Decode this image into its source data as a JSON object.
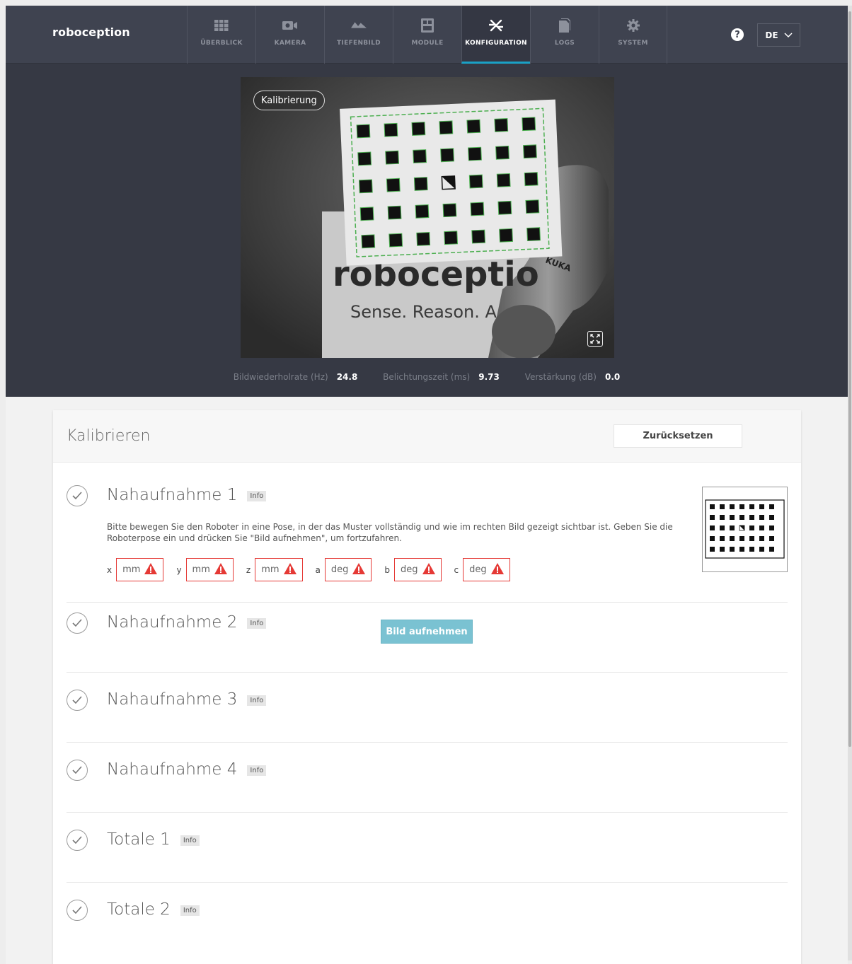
{
  "brand": "roboception",
  "nav": {
    "tabs": [
      {
        "label": "ÜBERBLICK",
        "icon": "grid-icon"
      },
      {
        "label": "KAMERA",
        "icon": "camera-icon"
      },
      {
        "label": "TIEFENBILD",
        "icon": "depth-icon"
      },
      {
        "label": "MODULE",
        "icon": "module-icon"
      },
      {
        "label": "KONFIGURATION",
        "icon": "tools-icon"
      },
      {
        "label": "LOGS",
        "icon": "document-icon"
      },
      {
        "label": "SYSTEM",
        "icon": "gear-icon"
      }
    ],
    "active_tab": "KONFIGURATION",
    "help_icon": "question-icon",
    "language": "DE"
  },
  "camera": {
    "badge": "Kalibrierung",
    "image_logo_text": "roboceptio",
    "image_slogan_text": "Sense. Reason. A",
    "image_robot_text": "KUKA",
    "expand_icon": "expand-icon",
    "stats": [
      {
        "label": "Bildwiederholrate (Hz)",
        "value": "24.8"
      },
      {
        "label": "Belichtungszeit (ms)",
        "value": "9.73"
      },
      {
        "label": "Verstärkung (dB)",
        "value": "0.0"
      }
    ]
  },
  "calibration": {
    "title": "Kalibrieren",
    "reset_label": "Zurücksetzen",
    "info_label": "Info",
    "active_step": {
      "title": "Nahaufnahme 1",
      "description": "Bitte bewegen Sie den Roboter in eine Pose, in der das Muster vollständig und wie im rechten Bild gezeigt sichtbar ist. Geben Sie die Roboterpose ein und drücken Sie \"Bild aufnehmen\", um fortzufahren.",
      "fields": [
        {
          "label": "x",
          "unit": "mm"
        },
        {
          "label": "y",
          "unit": "mm"
        },
        {
          "label": "z",
          "unit": "mm"
        },
        {
          "label": "a",
          "unit": "deg"
        },
        {
          "label": "b",
          "unit": "deg"
        },
        {
          "label": "c",
          "unit": "deg"
        }
      ],
      "capture_label": "Bild aufnehmen"
    },
    "steps": [
      {
        "title": "Nahaufnahme 2"
      },
      {
        "title": "Nahaufnahme 3"
      },
      {
        "title": "Nahaufnahme 4"
      },
      {
        "title": "Totale 1"
      },
      {
        "title": "Totale 2"
      }
    ]
  },
  "colors": {
    "nav_bg": "#3f4350",
    "accent": "#1aa1c6",
    "warning": "#e53935",
    "capture_button": "#7ac2d2"
  }
}
